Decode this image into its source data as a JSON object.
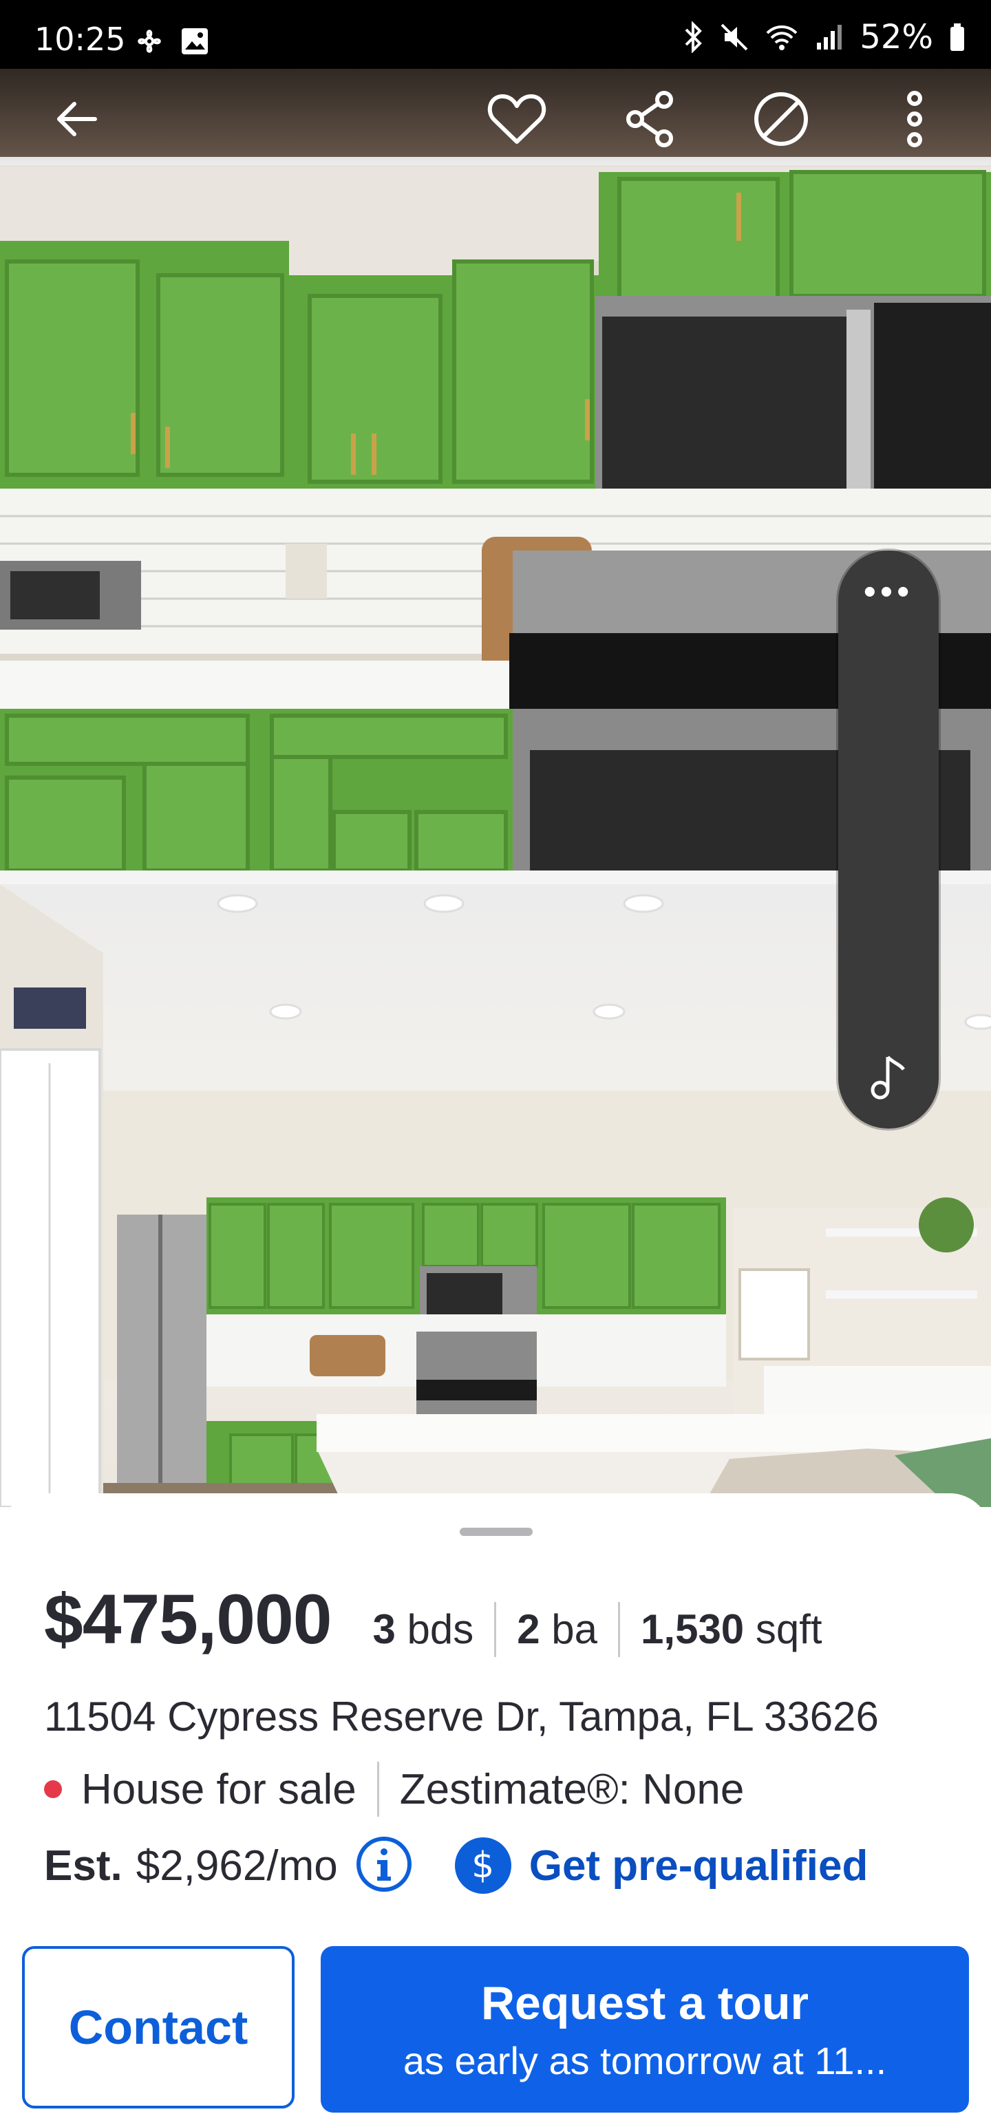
{
  "status_bar": {
    "time": "10:25",
    "battery": "52%",
    "left_icons": [
      "pinwheel-icon",
      "image-icon"
    ],
    "right_icons": [
      "bluetooth-icon",
      "mute-icon",
      "wifi-icon",
      "signal-icon",
      "battery-icon"
    ]
  },
  "nav": {
    "icons": [
      "back-arrow-icon",
      "heart-icon",
      "share-icon",
      "hide-icon",
      "more-vertical-icon"
    ]
  },
  "media_pill": {
    "dots": "•••",
    "icon": "music-note-icon"
  },
  "listing": {
    "price": "$475,000",
    "beds_value": "3",
    "beds_unit": "bds",
    "baths_value": "2",
    "baths_unit": "ba",
    "sqft_value": "1,530",
    "sqft_unit": "sqft",
    "address": "11504 Cypress Reserve Dr, Tampa, FL 33626",
    "status": "House for sale",
    "zestimate": "Zestimate®: None",
    "est_label": "Est.",
    "est_value": "$2,962/mo",
    "prequal_symbol": "$",
    "prequal_label": "Get pre-qualified"
  },
  "actions": {
    "contact_label": "Contact",
    "tour_label": "Request a tour",
    "tour_sub": "as early as tomorrow at 11..."
  },
  "colors": {
    "brand_blue": "#0f62e8",
    "status_red": "#e5394a",
    "cabinet_green": "#6cb24a"
  }
}
